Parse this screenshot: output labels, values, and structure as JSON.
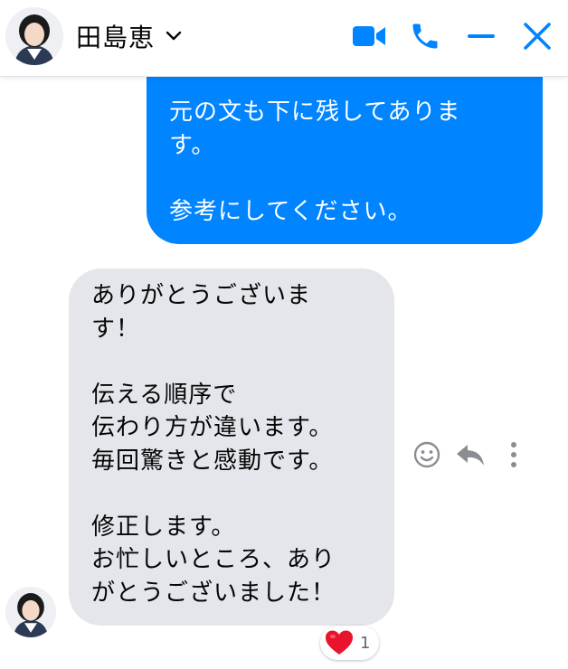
{
  "header": {
    "contact_name": "田島恵",
    "icons": [
      "avatar",
      "chevron-down-icon",
      "video-call-icon",
      "phone-icon",
      "minimize-icon",
      "close-icon"
    ],
    "accent_color": "#0084ff"
  },
  "messages": {
    "outgoing": {
      "text": "元の文も下に残してありま\nす。\n\n参考にしてください。"
    },
    "incoming": {
      "text": "ありがとうございま\nす！\n\n伝える順序で\n伝わり方が違います。\n毎回驚きと感動です。\n\n修正します。\nお忙しいところ、あり\nがとうございました！"
    },
    "reaction": {
      "emoji": "heart",
      "count": "1"
    },
    "actions": [
      "emoji-icon",
      "reply-icon",
      "more-icon"
    ]
  }
}
